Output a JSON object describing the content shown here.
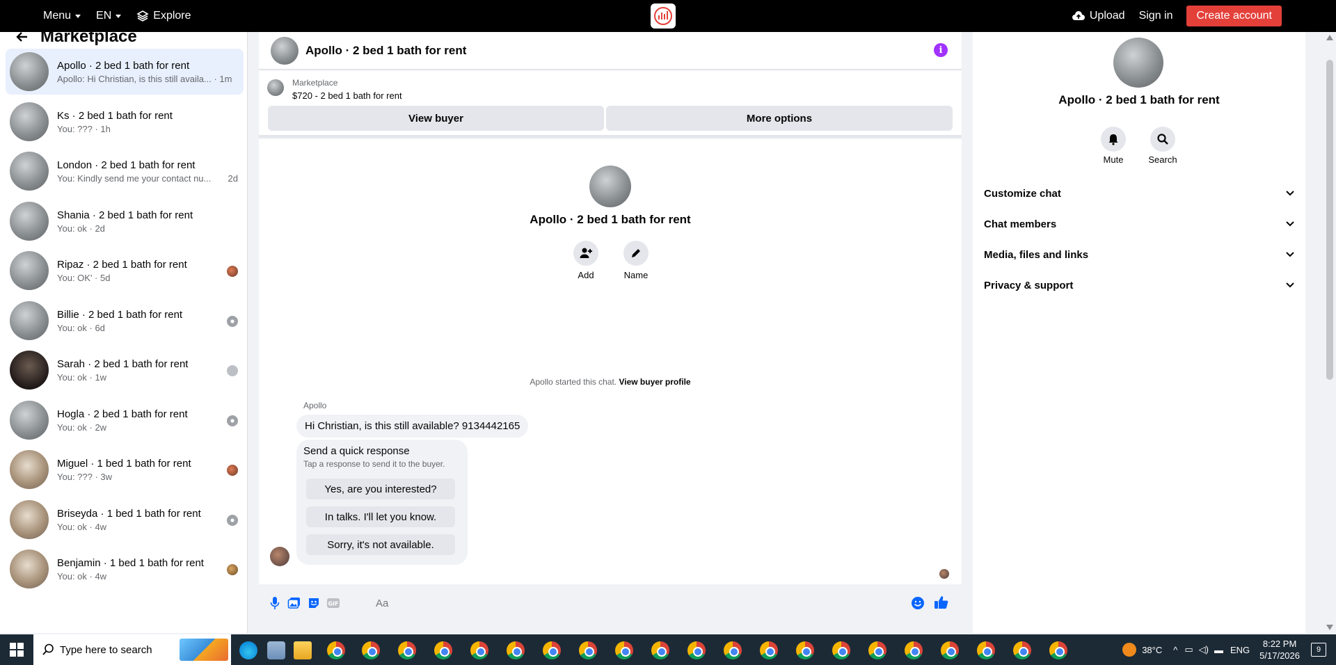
{
  "topbar": {
    "menu": "Menu",
    "lang": "EN",
    "explore": "Explore",
    "upload": "Upload",
    "signin": "Sign in",
    "create": "Create account"
  },
  "left": {
    "title": "Marketplace",
    "conversations": [
      {
        "name": "Apollo · 2 bed 1 bath for rent",
        "preview": "Apollo: Hi Christian, is this still availa...",
        "time": "· 1m"
      },
      {
        "name": "Ks · 2 bed 1 bath for rent",
        "preview": "You: ??? · 1h",
        "time": ""
      },
      {
        "name": "London · 2 bed 1 bath for rent",
        "preview": "You: Kindly send me your contact nu...",
        "time": "2d"
      },
      {
        "name": "Shania · 2 bed 1 bath for rent",
        "preview": "You: ok · 2d",
        "time": ""
      },
      {
        "name": "Ripaz · 2 bed 1 bath for rent",
        "preview": "You: OK' · 5d",
        "time": ""
      },
      {
        "name": "Billie · 2 bed 1 bath for rent",
        "preview": "You: ok · 6d",
        "time": ""
      },
      {
        "name": "Sarah · 2 bed 1 bath for rent",
        "preview": "You: ok · 1w",
        "time": ""
      },
      {
        "name": "Hogla · 2 bed 1 bath for rent",
        "preview": "You: ok · 2w",
        "time": ""
      },
      {
        "name": "Miguel · 1 bed 1 bath for rent",
        "preview": "You: ??? · 3w",
        "time": ""
      },
      {
        "name": "Briseyda · 1 bed 1 bath for rent",
        "preview": "You: ok · 4w",
        "time": ""
      },
      {
        "name": "Benjamin · 1 bed 1 bath for rent",
        "preview": "You: ok · 4w",
        "time": ""
      }
    ]
  },
  "center": {
    "header_title": "Apollo · 2 bed 1 bath for rent",
    "marketplace_label": "Marketplace",
    "listing": "$720 - 2 bed 1 bath for rent",
    "view_buyer": "View buyer",
    "more_options": "More options",
    "intro_title": "Apollo · 2 bed 1 bath for rent",
    "add_label": "Add",
    "name_label": "Name",
    "started_text": "Apollo started this chat.",
    "view_buyer_profile": "View buyer profile",
    "sender": "Apollo",
    "message": "Hi Christian, is this still available? 9134442165",
    "quick_title": "Send a quick response",
    "quick_sub": "Tap a response to send it to the buyer.",
    "quick_options": [
      "Yes, are you interested?",
      "In talks. I'll let you know.",
      "Sorry, it's not available."
    ],
    "input_placeholder": "Aa"
  },
  "right": {
    "title": "Apollo · 2 bed 1 bath for rent",
    "mute": "Mute",
    "search": "Search",
    "sections": [
      "Customize chat",
      "Chat members",
      "Media, files and links",
      "Privacy & support"
    ]
  },
  "taskbar": {
    "search_placeholder": "Type here to search",
    "temp": "38°C",
    "lang": "ENG",
    "time": "8:22 PM",
    "date": "5/17/2026",
    "notif_count": "9"
  },
  "colors": {
    "accent": "#0866ff",
    "brand_red": "#e4403a",
    "info_purple": "#a033ff"
  }
}
